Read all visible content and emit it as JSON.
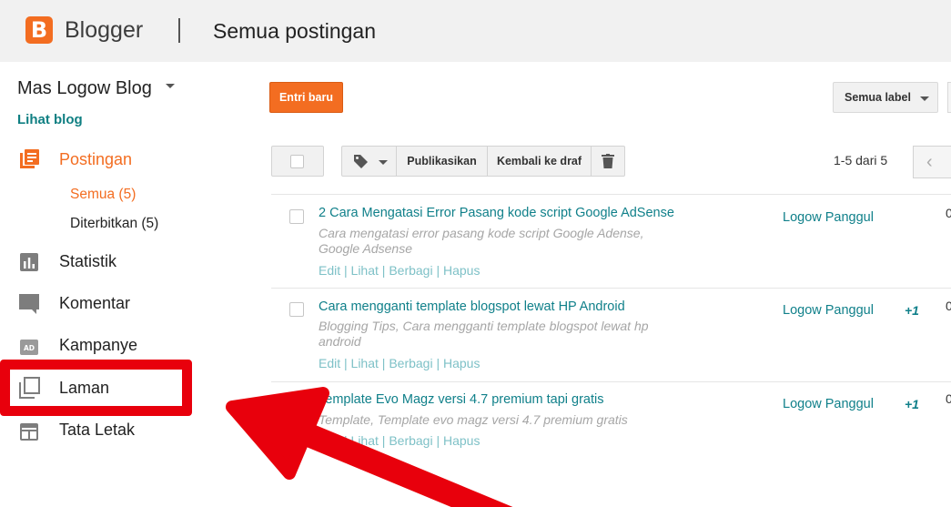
{
  "header": {
    "logo_letter": "B",
    "brand": "Blogger",
    "page_title": "Semua postingan"
  },
  "sidebar": {
    "blog_name": "Mas Logow Blog",
    "view_blog": "Lihat blog",
    "items": [
      {
        "label": "Postingan",
        "icon": "posts-icon",
        "active": true
      },
      {
        "label": "Statistik",
        "icon": "stats-icon",
        "active": false
      },
      {
        "label": "Komentar",
        "icon": "comment-icon",
        "active": false
      },
      {
        "label": "Kampanye",
        "icon": "ad-icon",
        "active": false
      },
      {
        "label": "Laman",
        "icon": "pages-icon",
        "active": false
      },
      {
        "label": "Tata Letak",
        "icon": "layout-icon",
        "active": false
      }
    ],
    "sub_items": [
      {
        "label": "Semua (5)",
        "active": true
      },
      {
        "label": "Diterbitkan (5)",
        "active": false
      }
    ]
  },
  "toolbar": {
    "new_post": "Entri baru",
    "label_filter": "Semua label",
    "publish": "Publikasikan",
    "revert_draft": "Kembali ke draf",
    "pager": "1-5 dari 5",
    "prev_glyph": "‹"
  },
  "posts": [
    {
      "title": "2 Cara Mengatasi Error Pasang kode script Google AdSense",
      "labels_line1": "Cara mengatasi error pasang kode script Google Adense,",
      "labels_line2": "Google Adsense",
      "actions": "Edit | Lihat | Berbagi | Hapus",
      "author": "Logow Panggul",
      "plus": "",
      "cut": "0"
    },
    {
      "title": "Cara mengganti template blogspot lewat HP Android",
      "labels_line1": "Blogging Tips, Cara mengganti template blogspot lewat hp",
      "labels_line2": "android",
      "actions": "Edit | Lihat | Berbagi | Hapus",
      "author": "Logow Panggul",
      "plus": "+1",
      "cut": "0"
    },
    {
      "title": "Template Evo Magz versi 4.7 premium tapi gratis",
      "labels_line1": "Template, Template evo magz versi 4.7 premium gratis",
      "labels_line2": "",
      "actions": "Edit | Lihat | Berbagi | Hapus",
      "author": "Logow Panggul",
      "plus": "+1",
      "cut": "0"
    }
  ],
  "colors": {
    "accent": "#f36d21",
    "link": "#10808a",
    "annotation": "#e8000c"
  }
}
